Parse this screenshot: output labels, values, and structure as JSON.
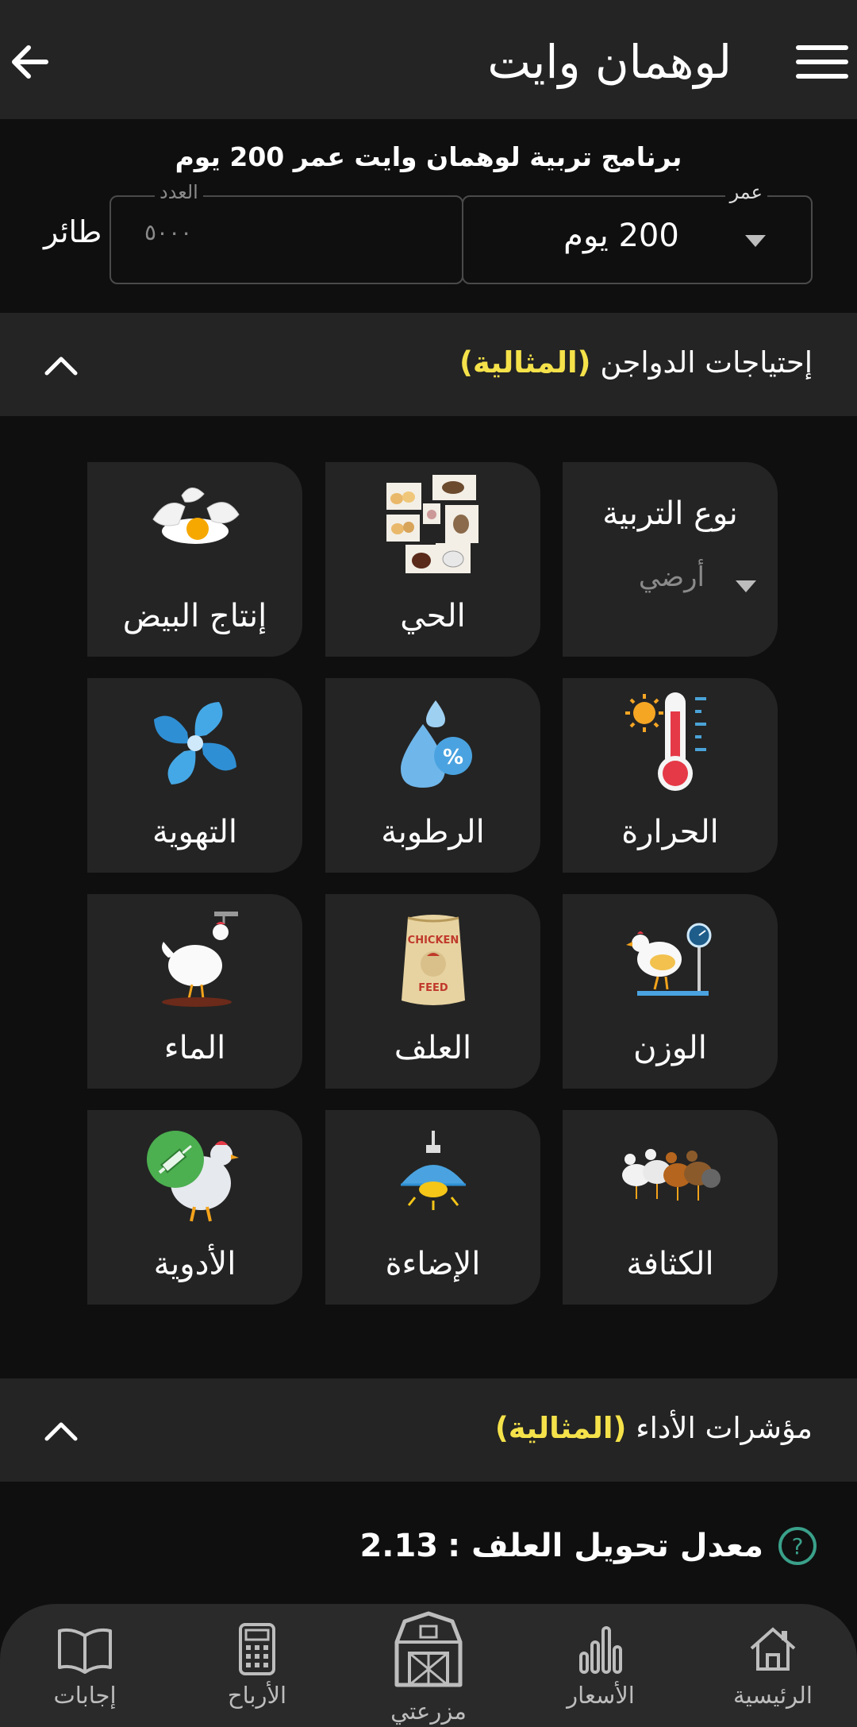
{
  "header": {
    "title": "لوهمان وايت",
    "menu_icon": "hamburger-menu-icon",
    "back_icon": "arrow-back-icon"
  },
  "program": {
    "title": "برنامج تربية لوهمان وايت عمر 200 يوم"
  },
  "inputs": {
    "age_label": "عمر",
    "age_value": "200 يوم",
    "count_label": "العدد",
    "count_placeholder": "٥٠٠٠",
    "bird_unit": "طائر"
  },
  "needs_section": {
    "title": "إحتياجات الدواجن",
    "highlight": "(المثالية)",
    "colors": {
      "highlight": "#f5e24a",
      "tile_bg": "#242424"
    }
  },
  "tiles": {
    "breeding_type": {
      "title": "نوع التربية",
      "value": "أرضي"
    },
    "live": {
      "label": "الحي"
    },
    "egg_production": {
      "label": "إنتاج البيض"
    },
    "temperature": {
      "label": "الحرارة"
    },
    "humidity": {
      "label": "الرطوبة"
    },
    "ventilation": {
      "label": "التهوية"
    },
    "weight": {
      "label": "الوزن"
    },
    "feed": {
      "label": "العلف"
    },
    "water": {
      "label": "الماء"
    },
    "density": {
      "label": "الكثافة"
    },
    "lighting": {
      "label": "الإضاءة"
    },
    "medicines": {
      "label": "الأدوية"
    }
  },
  "performance_section": {
    "title": "مؤشرات الأداء",
    "highlight": "(المثالية)"
  },
  "kpi": {
    "label": "معدل تحويل العلف :",
    "value": "2.13"
  },
  "bottom_nav": {
    "home": "الرئيسية",
    "prices": "الأسعار",
    "my_farm": "مزرعتي",
    "profits": "الأرباح",
    "answers": "إجابات"
  }
}
